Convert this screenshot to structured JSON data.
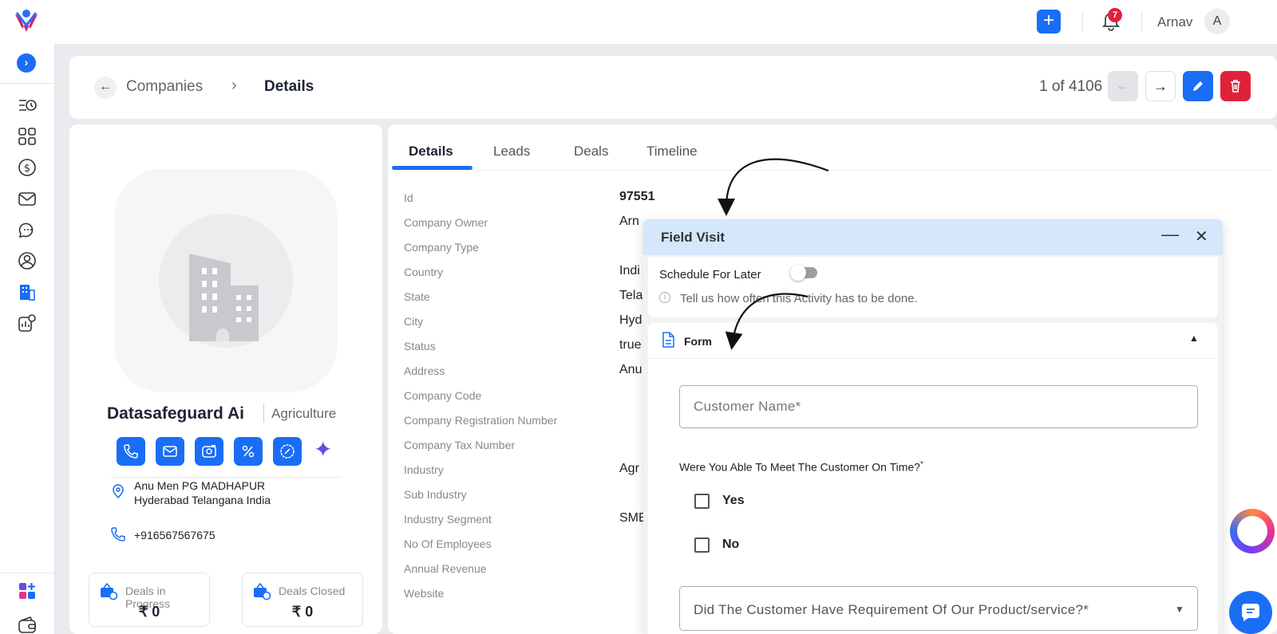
{
  "header": {
    "username": "Arnav",
    "avatar_initial": "A",
    "notification_count": "7",
    "add_label": "+"
  },
  "breadcrumb": {
    "parent": "Companies",
    "current": "Details",
    "pager": "1 of 4106"
  },
  "company": {
    "name": "Datasafeguard Ai",
    "industry": "Agriculture",
    "address_line1": "Anu Men PG MADHAPUR",
    "address_line2": "Hyderabad Telangana India",
    "phone": "+916567567675",
    "stats": [
      {
        "label": "Deals in Progress",
        "value": "₹ 0"
      },
      {
        "label": "Deals Closed",
        "value": "₹ 0"
      }
    ]
  },
  "tabs": [
    {
      "label": "Details"
    },
    {
      "label": "Leads"
    },
    {
      "label": "Deals"
    },
    {
      "label": "Timeline"
    }
  ],
  "fields": [
    {
      "label": "Id",
      "value": "97551"
    },
    {
      "label": "Company Owner",
      "value": "Arn"
    },
    {
      "label": "Company Type",
      "value": ""
    },
    {
      "label": "Country",
      "value": "Indi"
    },
    {
      "label": "State",
      "value": "Tela"
    },
    {
      "label": "City",
      "value": "Hyd"
    },
    {
      "label": "Status",
      "value": "true"
    },
    {
      "label": "Address",
      "value": "Anu"
    },
    {
      "label": "Company Code",
      "value": ""
    },
    {
      "label": "Company Registration Number",
      "value": ""
    },
    {
      "label": "Company Tax Number",
      "value": ""
    },
    {
      "label": "Industry",
      "value": "Agr"
    },
    {
      "label": "Sub Industry",
      "value": ""
    },
    {
      "label": "Industry Segment",
      "value": "SME"
    },
    {
      "label": "No Of Employees",
      "value": ""
    },
    {
      "label": "Annual Revenue",
      "value": ""
    },
    {
      "label": "Website",
      "value": ""
    }
  ],
  "modal": {
    "title": "Field Visit",
    "schedule_label": "Schedule For Later",
    "schedule_hint": "Tell us how often this Activity has to be done.",
    "form_title": "Form",
    "customer_name_placeholder": "Customer Name*",
    "question": "Were You Able To Meet The Customer On Time?",
    "question_star": "*",
    "options": [
      "Yes",
      "No"
    ],
    "requirement_placeholder": "Did The Customer Have Requirement Of Our Product/service?*"
  },
  "colors": {
    "primary": "#1a6ef5",
    "danger": "#e0213a",
    "modal_header": "#d5e7fa"
  },
  "icons": [
    "logo",
    "plus-icon",
    "bell-icon",
    "chevron-right-icon",
    "activity-list-icon",
    "dashboard-grid-icon",
    "dollar-icon",
    "mail-icon",
    "chat-icon",
    "contact-icon",
    "company-icon",
    "settings-report-icon",
    "apps-icon",
    "wallet-icon",
    "arrow-left-icon",
    "arrow-right-icon",
    "edit-icon",
    "trash-icon",
    "phone-icon",
    "video-icon",
    "percent-icon",
    "badge-icon",
    "sparkle-icon",
    "location-icon",
    "info-icon",
    "document-icon",
    "minimize-icon",
    "close-icon",
    "chat-bubble-icon"
  ]
}
